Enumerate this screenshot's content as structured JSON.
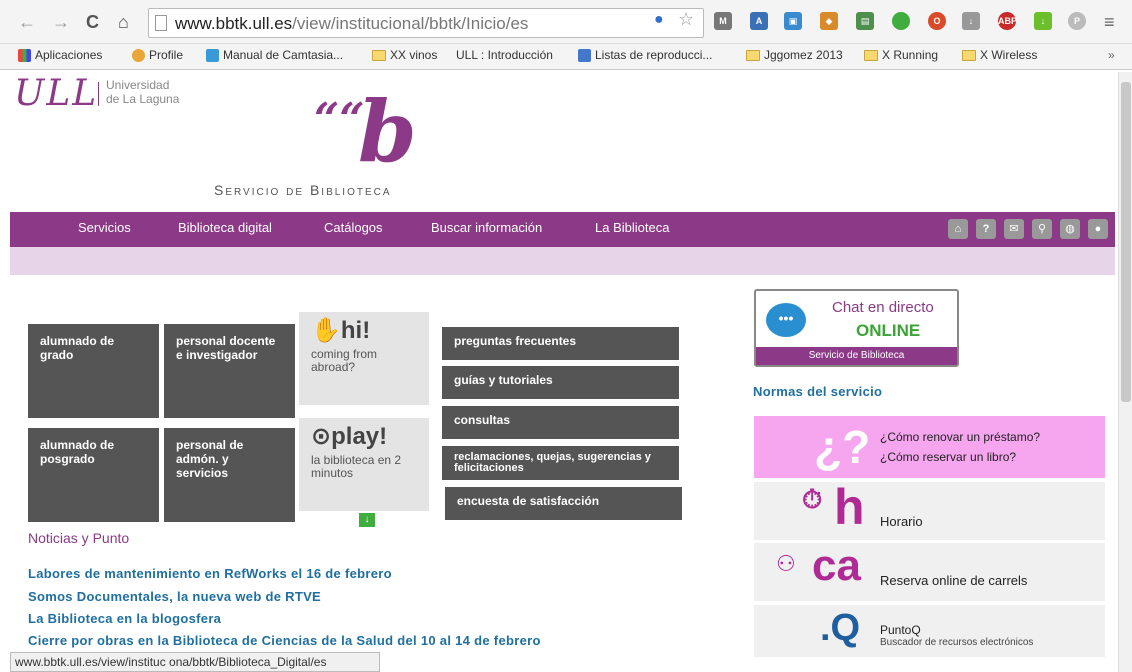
{
  "browser": {
    "url_host": "www.bbtk.ull.es",
    "url_path": "/view/institucional/bbtk/Inicio/es",
    "bookmarks": [
      {
        "label": "Aplicaciones"
      },
      {
        "label": "Profile"
      },
      {
        "label": "Manual de Camtasia..."
      },
      {
        "label": "XX vinos"
      },
      {
        "label": "ULL : Introducción"
      },
      {
        "label": "Listas de reproducci..."
      },
      {
        "label": "Jggomez 2013"
      },
      {
        "label": "X Running"
      },
      {
        "label": "X Wireless"
      }
    ],
    "more_bookmarks": "»",
    "status_url": "www.bbtk.ull.es/view/instituc ona/bbtk/Biblioteca_Digital/es"
  },
  "header": {
    "ull_logo": "ULL",
    "university_line1": "Universidad",
    "university_line2": "de La Laguna",
    "bib_quote": "““",
    "bib_b": "b",
    "service_title": "Servicio de Biblioteca"
  },
  "nav": {
    "items": [
      "Servicios",
      "Biblioteca digital",
      "Catálogos",
      "Buscar información",
      "La Biblioteca"
    ],
    "icons": [
      "home-icon",
      "help-icon",
      "mail-icon",
      "search-icon",
      "globe-icon",
      "user-icon"
    ]
  },
  "tiles": {
    "grado": "alumnado de grado",
    "pdi": "personal docente e investigador",
    "posgrado": "alumnado de posgrado",
    "pas": "personal de admón. y servicios",
    "hi_title": "hi!",
    "hi_sub": "coming from abroad?",
    "play_title": "play!",
    "play_sub": "la biblioteca en 2 minutos"
  },
  "links": {
    "faq": "preguntas frecuentes",
    "guides": "guías y tutoriales",
    "queries": "consultas",
    "complaints": "reclamaciones, quejas, sugerencias y felicitaciones",
    "survey": "encuesta de satisfacción"
  },
  "news": {
    "heading": "Noticias y Punto",
    "items": [
      "Labores de mantenimiento en RefWorks el 16 de febrero",
      "Somos Documentales, la nueva web de RTVE",
      "La Biblioteca en la blogosfera",
      "Cierre por obras en la Biblioteca de Ciencias de la Salud del 10 al 14 de febrero"
    ]
  },
  "sidebar": {
    "chat_l1": "Chat en directo",
    "chat_l2": "ONLINE",
    "chat_foot": "Servicio de Biblioteca",
    "normas": "Normas del servicio",
    "renew_q": "¿?",
    "renew_link": "¿Cómo renovar un préstamo?",
    "reserve_link": "¿Cómo reservar un libro?",
    "horario_ic": "h",
    "horario": "Horario",
    "carrels_ic": "ca",
    "carrels": "Reserva online de carrels",
    "puntoq_ic": ".Q",
    "puntoq": "PuntoQ",
    "puntoq_sub": "Buscador de recursos electrónicos"
  },
  "colors": {
    "brand": "#8c3a87",
    "tile": "#555555",
    "link": "#1f6fa0",
    "pink": "#f5a6ee"
  }
}
